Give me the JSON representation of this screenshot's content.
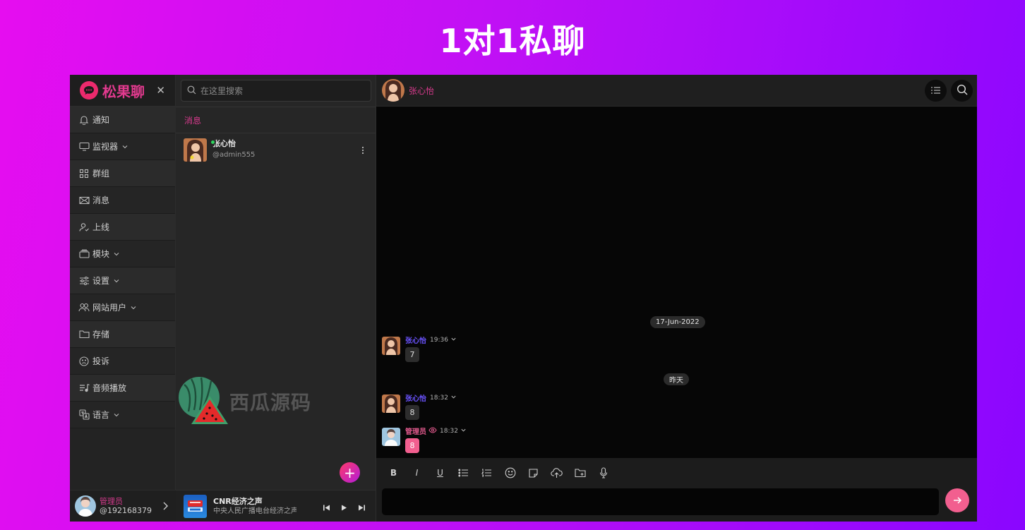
{
  "banner": {
    "title": "1对1私聊"
  },
  "sidebar": {
    "brand": "松果聊",
    "items": [
      {
        "label": "通知",
        "icon": "bell-icon"
      },
      {
        "label": "监视器",
        "icon": "monitor-icon",
        "expandable": true
      },
      {
        "label": "群组",
        "icon": "grid-icon"
      },
      {
        "label": "消息",
        "icon": "mail-icon"
      },
      {
        "label": "上线",
        "icon": "user-check-icon"
      },
      {
        "label": "模块",
        "icon": "layers-icon",
        "expandable": true
      },
      {
        "label": "设置",
        "icon": "sliders-icon",
        "expandable": true
      },
      {
        "label": "网站用户",
        "icon": "users-icon",
        "expandable": true
      },
      {
        "label": "存储",
        "icon": "folder-icon"
      },
      {
        "label": "投诉",
        "icon": "sad-face-icon"
      },
      {
        "label": "音频播放",
        "icon": "music-list-icon"
      },
      {
        "label": "语言",
        "icon": "translate-icon",
        "expandable": true
      }
    ],
    "user": {
      "name": "管理员",
      "id": "@192168379"
    }
  },
  "list": {
    "search_placeholder": "在这里搜索",
    "header": "消息",
    "contacts": [
      {
        "name": "张心怡",
        "handle": "@admin555",
        "online": true
      }
    ],
    "watermark": "西瓜源码"
  },
  "player": {
    "title": "CNR经济之声",
    "subtitle": "中央人民广播电台经济之声"
  },
  "chat": {
    "contact_name": "张心怡",
    "dates": [
      "17-Jun-2022",
      "昨天"
    ],
    "messages": [
      {
        "sender": "张心怡",
        "time": "19:36",
        "text": "7"
      },
      {
        "sender": "张心怡",
        "time": "18:32",
        "text": "8"
      },
      {
        "sender": "管理员",
        "time": "18:32",
        "text": "8",
        "me": true
      }
    ],
    "toolbar": [
      "B",
      "I",
      "U"
    ]
  },
  "colors": {
    "accent": "#f25f8f",
    "brand": "#e33a8f",
    "sender": "#6b54ff"
  }
}
